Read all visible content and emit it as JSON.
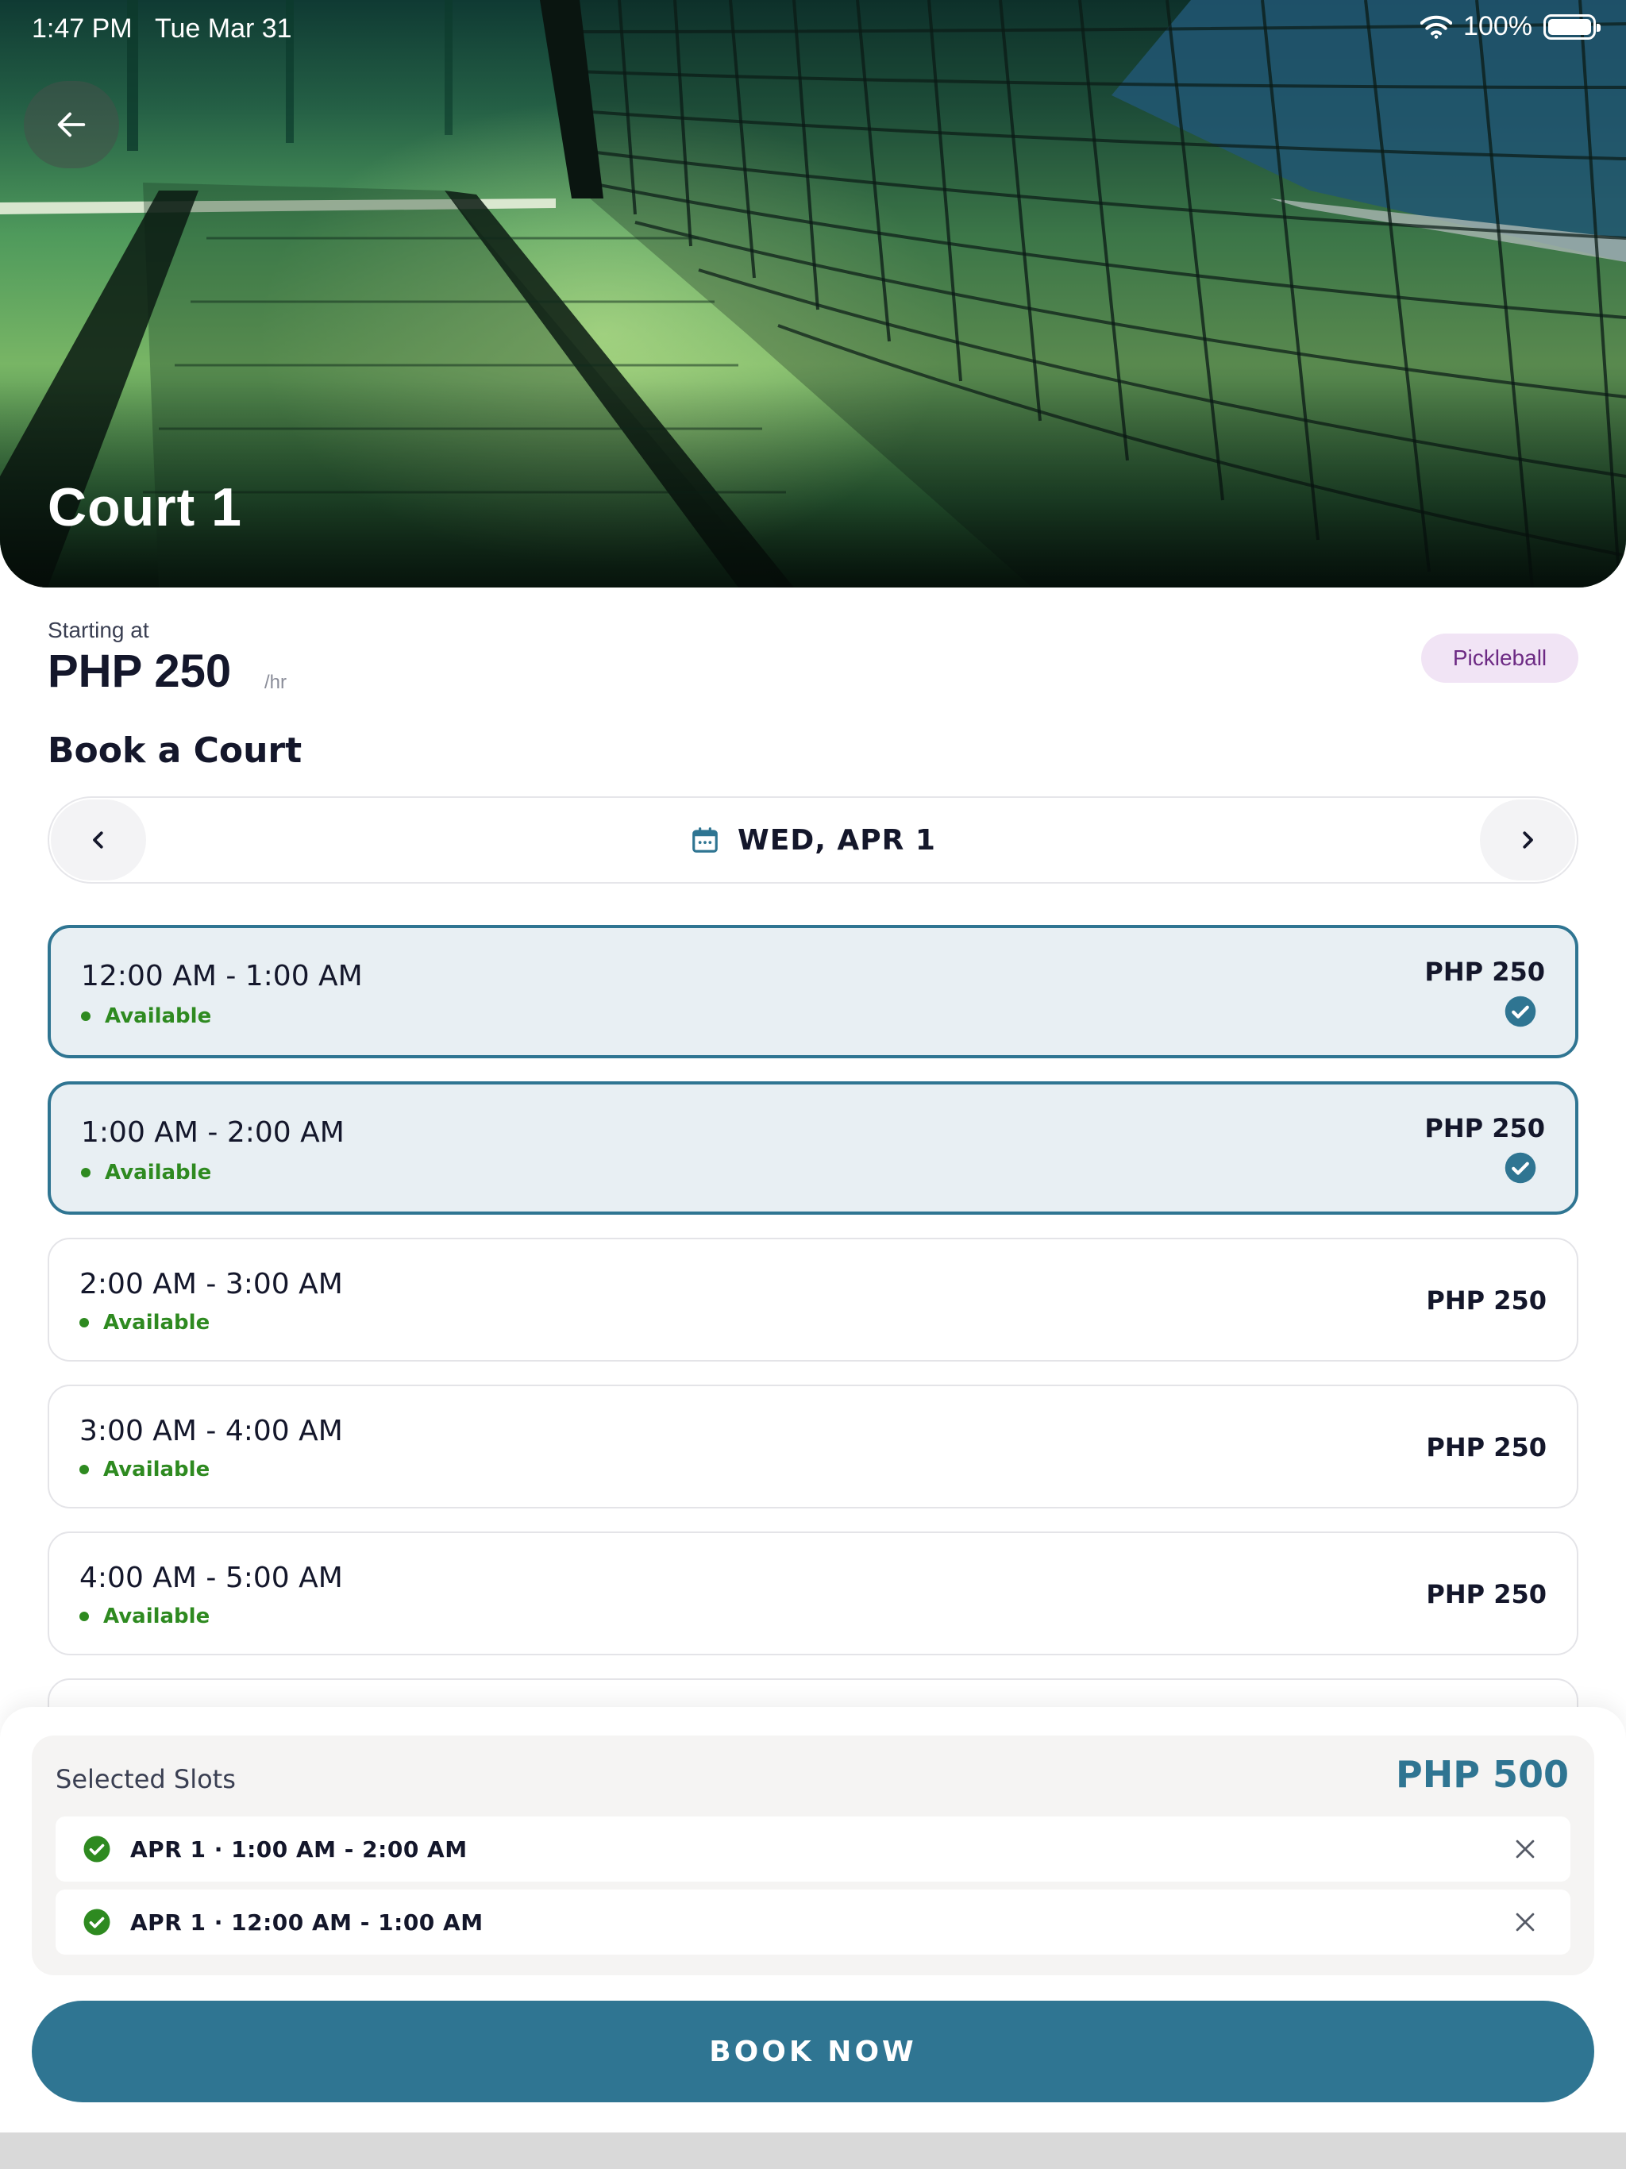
{
  "status_bar": {
    "time": "1:47 PM",
    "date": "Tue Mar 31",
    "battery": "100%"
  },
  "hero": {
    "title": "Court 1"
  },
  "pricing": {
    "starting_label": "Starting at",
    "price": "PHP 250",
    "unit": "/hr",
    "sport_tag": "Pickleball"
  },
  "booking": {
    "section_title": "Book a Court",
    "date_label": "WED, APR 1",
    "slots": [
      {
        "time": "12:00 AM - 1:00 AM",
        "status": "Available",
        "price": "PHP 250",
        "selected": true
      },
      {
        "time": "1:00 AM - 2:00 AM",
        "status": "Available",
        "price": "PHP 250",
        "selected": true
      },
      {
        "time": "2:00 AM - 3:00 AM",
        "status": "Available",
        "price": "PHP 250",
        "selected": false
      },
      {
        "time": "3:00 AM - 4:00 AM",
        "status": "Available",
        "price": "PHP 250",
        "selected": false
      },
      {
        "time": "4:00 AM - 5:00 AM",
        "status": "Available",
        "price": "PHP 250",
        "selected": false
      }
    ]
  },
  "summary": {
    "title": "Selected Slots",
    "total": "PHP 500",
    "items": [
      {
        "label": "APR 1 · 1:00 AM - 2:00 AM"
      },
      {
        "label": "APR 1 · 12:00 AM - 1:00 AM"
      }
    ]
  },
  "cta": {
    "label": "BOOK NOW"
  },
  "colors": {
    "primary": "#2f7592",
    "available": "#2e8a20",
    "tag_bg": "#f1e4f5",
    "tag_text": "#6d2a84"
  }
}
